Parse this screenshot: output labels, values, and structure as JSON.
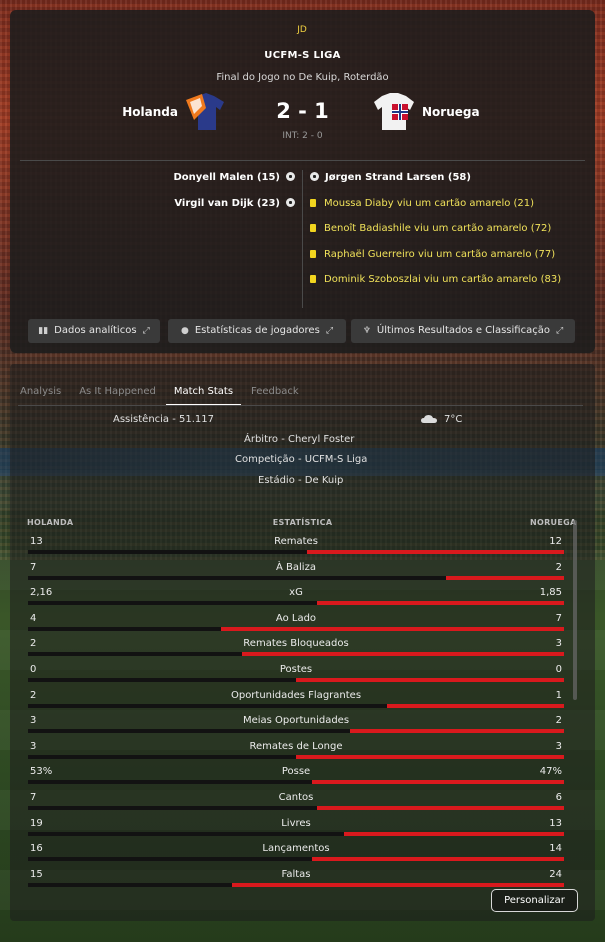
{
  "header": {
    "logo": "JD",
    "league": "UCFM-S LIGA",
    "venue": "Final do Jogo no De Kuip, Roterdão",
    "home_team": "Holanda",
    "away_team": "Noruega",
    "score": "2 - 1",
    "halftime": "INT: 2 - 0"
  },
  "events": {
    "home": [
      {
        "text": "Donyell Malen (15)",
        "type": "goal"
      },
      {
        "text": "Virgil van Dijk (23)",
        "type": "goal"
      }
    ],
    "away": [
      {
        "text": "Jørgen Strand Larsen (58)",
        "type": "goal"
      },
      {
        "text": "Moussa Diaby viu um cartão amarelo (21)",
        "type": "card"
      },
      {
        "text": "Benoît Badiashile viu um cartão amarelo (72)",
        "type": "card"
      },
      {
        "text": "Raphaël Guerreiro viu um cartão amarelo (77)",
        "type": "card"
      },
      {
        "text": "Dominik Szoboszlai viu um cartão amarelo (83)",
        "type": "card"
      }
    ]
  },
  "buttons": {
    "analytics": "Dados analíticos",
    "player_stats": "Estatísticas de jogadores",
    "latest_results": "Últimos Resultados e Classificação",
    "customize": "Personalizar"
  },
  "tabs": [
    {
      "label": "Analysis",
      "active": false
    },
    {
      "label": "As It Happened",
      "active": false
    },
    {
      "label": "Match Stats",
      "active": true
    },
    {
      "label": "Feedback",
      "active": false
    }
  ],
  "match_info": {
    "attendance": "Assistência  -  51.117",
    "temperature": "7°C",
    "referee": "Árbitro  -  Cheryl Foster",
    "competition": "Competição  -  UCFM-S Liga",
    "stadium": "Estádio  -  De Kuip"
  },
  "stats_header": {
    "home": "HOLANDA",
    "title": "ESTATÍSTICA",
    "away": "NORUEGA"
  },
  "stats": [
    {
      "name": "Remates",
      "home": "13",
      "away": "12",
      "home_share": 0.52
    },
    {
      "name": "À Baliza",
      "home": "7",
      "away": "2",
      "home_share": 0.78
    },
    {
      "name": "xG",
      "home": "2,16",
      "away": "1,85",
      "home_share": 0.54
    },
    {
      "name": "Ao Lado",
      "home": "4",
      "away": "7",
      "home_share": 0.36
    },
    {
      "name": "Remates Bloqueados",
      "home": "2",
      "away": "3",
      "home_share": 0.4
    },
    {
      "name": "Postes",
      "home": "0",
      "away": "0",
      "home_share": 0.5
    },
    {
      "name": "Oportunidades Flagrantes",
      "home": "2",
      "away": "1",
      "home_share": 0.67
    },
    {
      "name": "Meias Oportunidades",
      "home": "3",
      "away": "2",
      "home_share": 0.6
    },
    {
      "name": "Remates de Longe",
      "home": "3",
      "away": "3",
      "home_share": 0.5
    },
    {
      "name": "Posse",
      "home": "53%",
      "away": "47%",
      "home_share": 0.53
    },
    {
      "name": "Cantos",
      "home": "7",
      "away": "6",
      "home_share": 0.54
    },
    {
      "name": "Livres",
      "home": "19",
      "away": "13",
      "home_share": 0.59
    },
    {
      "name": "Lançamentos",
      "home": "16",
      "away": "14",
      "home_share": 0.53
    },
    {
      "name": "Faltas",
      "home": "15",
      "away": "24",
      "home_share": 0.38
    }
  ],
  "colors": {
    "away_bar": "#d9191d",
    "home_bar": "#121212",
    "card": "#f2d51f",
    "card_text": "#f1e25a"
  }
}
